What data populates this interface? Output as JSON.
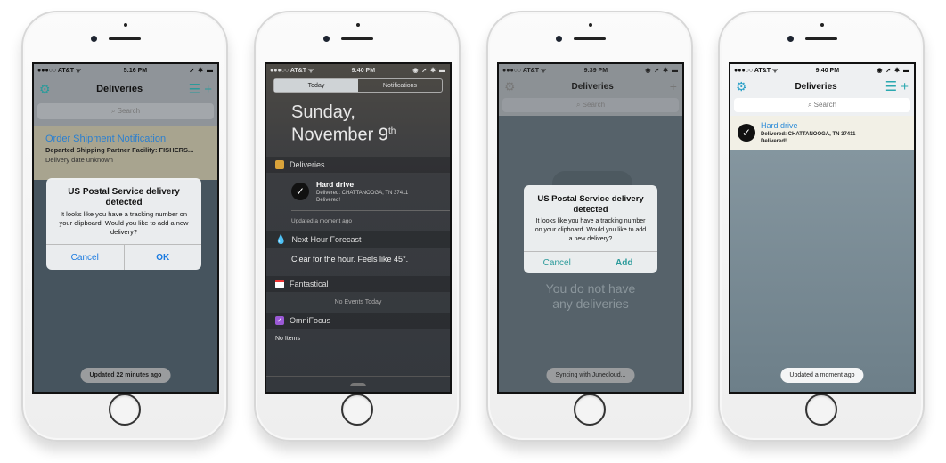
{
  "phone1": {
    "status": {
      "carrier": "●●●○○ AT&T ᯤ",
      "time": "5:16 PM",
      "right": "➚ ✱ ▬"
    },
    "nav": {
      "title": "Deliveries",
      "settings_icon": "gear-icon",
      "list_icon": "list-icon",
      "add_icon": "plus-icon"
    },
    "search_placeholder": "⌕ Search",
    "item": {
      "title": "Order Shipment Notification",
      "line1": "Departed Shipping Partner Facility: FISHERS...",
      "line2": "Delivery date unknown"
    },
    "alert": {
      "title": "US Postal Service delivery detected",
      "message": "It looks like you have a tracking number on your clipboard. Would you like to add a new delivery?",
      "cancel": "Cancel",
      "confirm": "OK"
    },
    "pill": "Updated 22 minutes ago"
  },
  "phone2": {
    "status": {
      "carrier": "●●●○○ AT&T ᯤ",
      "time": "9:40 PM",
      "right": "◉ ➚ ✱ ▬"
    },
    "tabs": [
      "Today",
      "Notifications"
    ],
    "date_line1": "Sunday,",
    "date_line2": "November 9",
    "date_sup": "th",
    "widgets": {
      "deliveries": {
        "name": "Deliveries",
        "item_title": "Hard drive",
        "item_line1": "Delivered: CHATTANOOGA, TN 37411",
        "item_line2": "Delivered!",
        "updated": "Updated a moment ago"
      },
      "forecast": {
        "name": "Next Hour Forecast",
        "text": "Clear for the hour. Feels like 45°."
      },
      "fantastical": {
        "name": "Fantastical",
        "text": "No Events Today"
      },
      "omnifocus": {
        "name": "OmniFocus",
        "text": "No Items"
      }
    }
  },
  "phone3": {
    "status": {
      "carrier": "●●●○○ AT&T ᯤ",
      "time": "9:39 PM",
      "right": "◉ ➚ ✱ ▬"
    },
    "nav": {
      "title": "Deliveries"
    },
    "search_placeholder": "⌕ Search",
    "alert": {
      "title": "US Postal Service delivery detected",
      "message": "It looks like you have a tracking number on your clipboard. Would you like to add a new delivery?",
      "cancel": "Cancel",
      "confirm": "Add"
    },
    "empty_line1": "You do not have",
    "empty_line2": "any deliveries",
    "pill": "Syncing with Junecloud..."
  },
  "phone4": {
    "status": {
      "carrier": "●●●○○ AT&T ᯤ",
      "time": "9:40 PM",
      "right": "◉ ➚ ✱ ▬"
    },
    "nav": {
      "title": "Deliveries"
    },
    "search_placeholder": "⌕ Search",
    "item": {
      "title": "Hard drive",
      "line1": "Delivered: CHATTANOOGA, TN 37411",
      "line2": "Delivered!"
    },
    "pill": "Updated a moment ago"
  },
  "colors": {
    "accent": "#2a9a9a",
    "link_blue": "#2a7fd0",
    "alert_blue": "#1a7ae0"
  }
}
